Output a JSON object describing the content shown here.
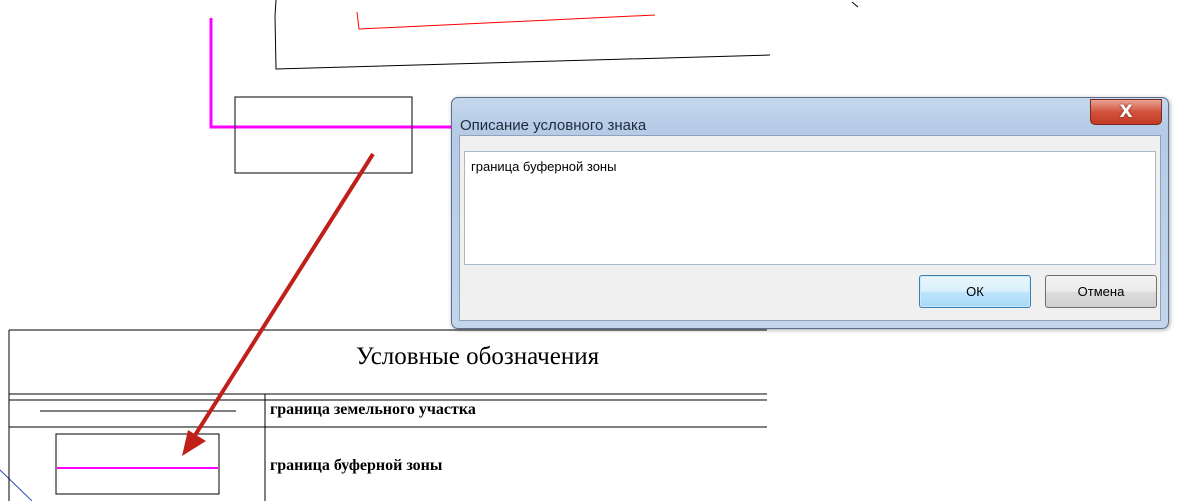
{
  "dialog": {
    "title": "Описание условного знака",
    "close_glyph": "X",
    "description_value": "граница буферной зоны",
    "ok_label": "ОК",
    "cancel_label": "Отмена"
  },
  "legend": {
    "title": "Условные обозначения",
    "rows": [
      {
        "label": "граница земельного участка",
        "symbol": "black-line"
      },
      {
        "label": "граница буферной зоны",
        "symbol": "magenta-line-box"
      }
    ]
  },
  "colors": {
    "buffer_zone": "#ff00ff",
    "land_plot": "#000000",
    "red_line": "#ff0000",
    "arrow": "#c0201a",
    "dialog_frame": "#b9cfe8"
  }
}
